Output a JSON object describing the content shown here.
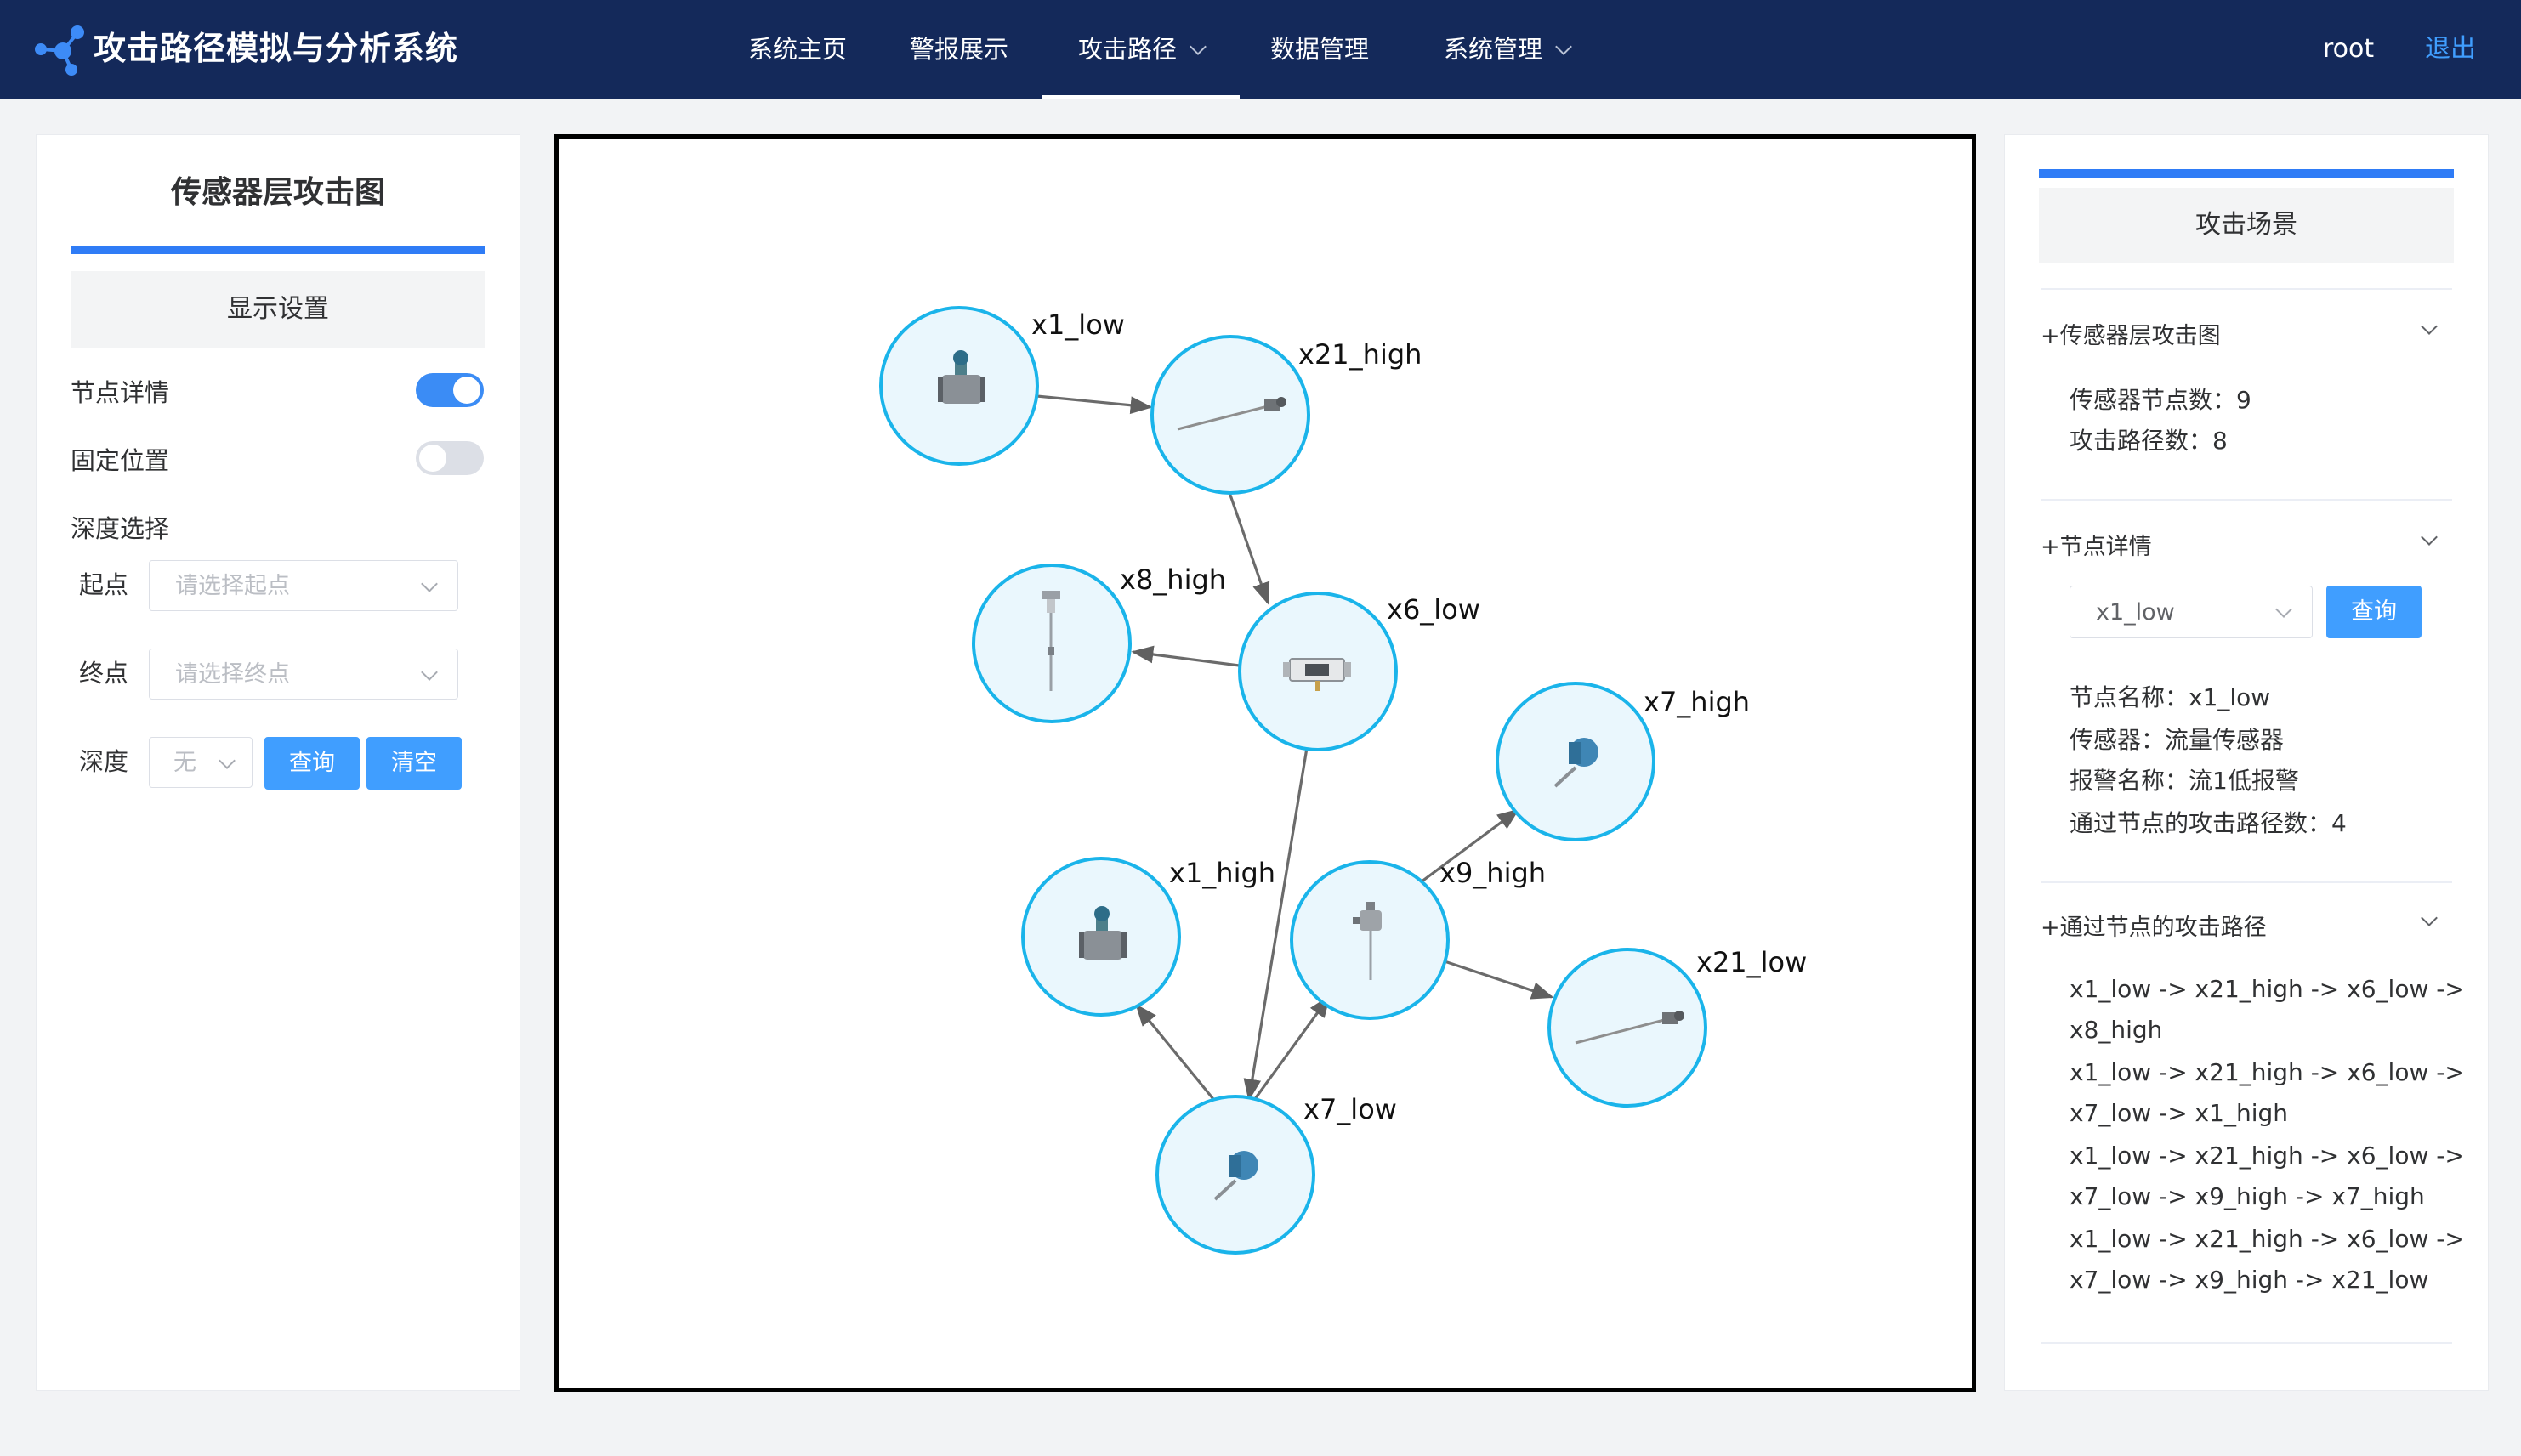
{
  "app": {
    "title": "攻击路径模拟与分析系统"
  },
  "nav": {
    "items": [
      {
        "label": "系统主页"
      },
      {
        "label": "警报展示"
      },
      {
        "label": "攻击路径"
      },
      {
        "label": "数据管理"
      },
      {
        "label": "系统管理"
      }
    ],
    "active": "攻击路径",
    "user": "root",
    "logout": "退出"
  },
  "left_panel": {
    "title": "传感器层攻击图",
    "display_settings": "显示设置",
    "node_detail_label": "节点详情",
    "node_detail_on": true,
    "fixed_position_label": "固定位置",
    "fixed_position_on": false,
    "depth_section_label": "深度选择",
    "start_label": "起点",
    "start_placeholder": "请选择起点",
    "end_label": "终点",
    "end_placeholder": "请选择终点",
    "depth_label": "深度",
    "depth_value": "无",
    "query_button": "查询",
    "clear_button": "清空"
  },
  "graph": {
    "nodes": [
      {
        "id": "x1_low",
        "icon": "flow-sensor-icon"
      },
      {
        "id": "x21_high",
        "icon": "thermocouple-probe-icon"
      },
      {
        "id": "x8_high",
        "icon": "level-probe-icon"
      },
      {
        "id": "x6_low",
        "icon": "inline-flowmeter-icon"
      },
      {
        "id": "x7_high",
        "icon": "pressure-transmitter-icon"
      },
      {
        "id": "x1_high",
        "icon": "flow-sensor-icon"
      },
      {
        "id": "x9_high",
        "icon": "temperature-transmitter-icon"
      },
      {
        "id": "x21_low",
        "icon": "thermocouple-probe-icon"
      },
      {
        "id": "x7_low",
        "icon": "pressure-transmitter-icon"
      }
    ],
    "edges": [
      {
        "from": "x1_low",
        "to": "x21_high"
      },
      {
        "from": "x21_high",
        "to": "x6_low"
      },
      {
        "from": "x6_low",
        "to": "x8_high"
      },
      {
        "from": "x6_low",
        "to": "x7_low"
      },
      {
        "from": "x7_low",
        "to": "x1_high"
      },
      {
        "from": "x7_low",
        "to": "x9_high"
      },
      {
        "from": "x9_high",
        "to": "x7_high"
      },
      {
        "from": "x9_high",
        "to": "x21_low"
      }
    ]
  },
  "right_panel": {
    "header": "攻击场景",
    "section1": {
      "title": "+传感器层攻击图",
      "sensor_nodes": "传感器节点数：9",
      "attack_paths": "攻击路径数：8"
    },
    "section2": {
      "title": "+节点详情",
      "selected_node": "x1_low",
      "query_button": "查询",
      "node_name": "节点名称：x1_low",
      "sensor": "传感器：流量传感器",
      "alarm_name": "报警名称：流1低报警",
      "path_count": "通过节点的攻击路径数：4"
    },
    "section3": {
      "title": "+通过节点的攻击路径",
      "lines": [
        "x1_low -> x21_high -> x6_low ->",
        "x8_high",
        "x1_low -> x21_high -> x6_low ->",
        "x7_low -> x1_high",
        "x1_low -> x21_high -> x6_low ->",
        "x7_low -> x9_high -> x7_high",
        "x1_low -> x21_high -> x6_low ->",
        "x7_low -> x9_high -> x21_low"
      ]
    }
  }
}
